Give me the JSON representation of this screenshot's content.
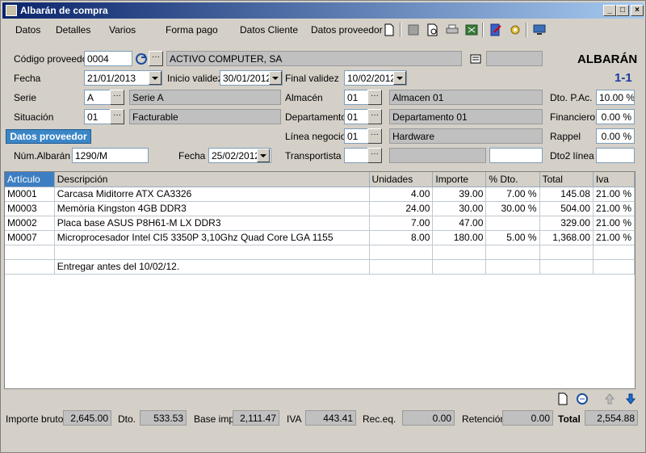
{
  "window": {
    "title": "Albarán de compra"
  },
  "menu": [
    "Datos",
    "Detalles",
    "Varios",
    "Forma pago",
    "Datos Cliente",
    "Datos proveedor"
  ],
  "header": {
    "doc_type": "ALBARÁN",
    "doc_number": "1-1",
    "codigo_proveedor_label": "Código proveedor",
    "codigo_proveedor": "0004",
    "proveedor_nombre": "ACTIVO COMPUTER, SA",
    "fecha_label": "Fecha",
    "fecha": "21/01/2013",
    "inicio_validez_label": "Inicio validez",
    "inicio_validez": "30/01/2012",
    "final_validez_label": "Final validez",
    "final_validez": "10/02/2012",
    "serie_label": "Serie",
    "serie": "A",
    "serie_nombre": "Serie A",
    "situacion_label": "Situación",
    "situacion": "01",
    "situacion_nombre": "Facturable",
    "almacen_label": "Almacén",
    "almacen": "01",
    "almacen_nombre": "Almacen 01",
    "departamento_label": "Departamento",
    "departamento": "01",
    "departamento_nombre": "Departamento 01",
    "linea_negocio_label": "Línea negocio",
    "linea_negocio": "01",
    "linea_negocio_nombre": "Hardware",
    "transportista_label": "Transportista",
    "dto_pac_label": "Dto. P.Ac.",
    "dto_pac": "10.00 %",
    "financiero_label": "Financiero",
    "financiero": "0.00 %",
    "rappel_label": "Rappel",
    "rappel": "0.00 %",
    "dto2_label": "Dto2 línea",
    "datos_proveedor_tab": "Datos proveedor",
    "num_albaran_label": "Núm.Albarán",
    "num_albaran": "1290/M",
    "fecha2_label": "Fecha",
    "fecha2": "25/02/2012"
  },
  "table": {
    "columns": [
      "Artículo",
      "Descripción",
      "Unidades",
      "Importe",
      "% Dto.",
      "Total",
      "Iva"
    ],
    "rows": [
      [
        "M0001",
        "Carcasa Miditorre ATX CA3326",
        "4.00",
        "39.00",
        "7.00 %",
        "145.08",
        "21.00 %"
      ],
      [
        "M0003",
        "Memòria Kingston 4GB DDR3",
        "24.00",
        "30.00",
        "30.00 %",
        "504.00",
        "21.00 %"
      ],
      [
        "M0002",
        "Placa base ASUS P8H61-M LX DDR3",
        "7.00",
        "47.00",
        "",
        "329.00",
        "21.00 %"
      ],
      [
        "M0007",
        "Microprocesador Intel CI5 3350P 3,10Ghz Quad Core LGA 1155",
        "8.00",
        "180.00",
        "5.00 %",
        "1,368.00",
        "21.00 %"
      ],
      [
        "",
        "",
        "",
        "",
        "",
        "",
        ""
      ],
      [
        "",
        "Entregar antes del 10/02/12.",
        "",
        "",
        "",
        "",
        ""
      ]
    ]
  },
  "footer": {
    "importe_bruto_label": "Importe bruto",
    "importe_bruto": "2,645.00",
    "dto_label": "Dto.",
    "dto": "533.53",
    "base_imp_label": "Base imp.",
    "base_imp": "2,111.47",
    "iva_label": "IVA",
    "iva": "443.41",
    "rec_eq_label": "Rec.eq.",
    "rec_eq": "0.00",
    "retencion_label": "Retención",
    "retencion": "0.00",
    "total_label": "Total",
    "total": "2,554.88"
  },
  "colors": {
    "accent": "#3b86c6",
    "title_start": "#0a246a",
    "doc_number": "#1a3aa6"
  }
}
